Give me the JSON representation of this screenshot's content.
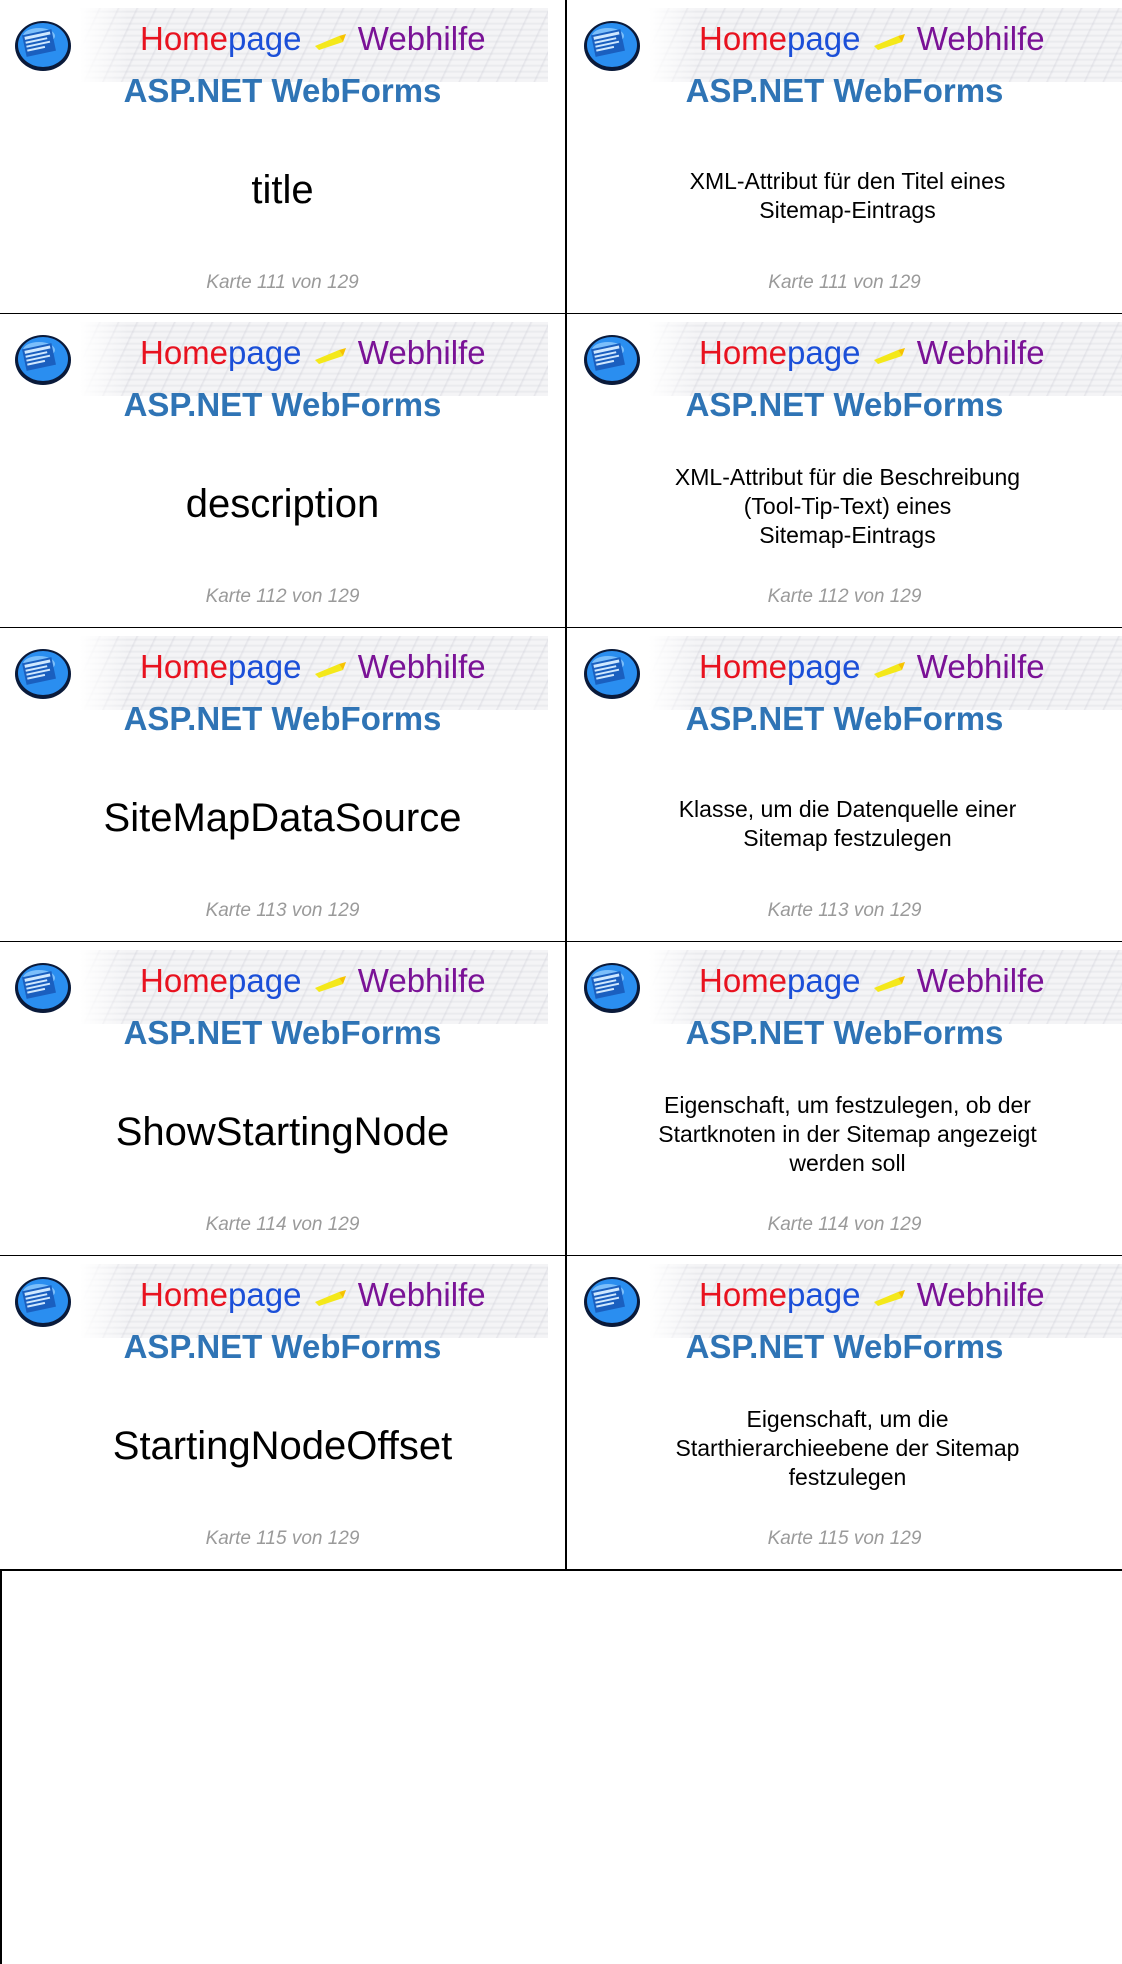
{
  "brand": {
    "home": "Home",
    "page": "page",
    "web": "Webhilfe"
  },
  "subject": "ASP.NET WebForms",
  "colors": {
    "subject": "#2f74b5",
    "home": "#e8121f",
    "page": "#1b4fd8",
    "web": "#7a1296",
    "footer": "#9a9a9a"
  },
  "cards": [
    {
      "term": "title",
      "answer": [
        "XML-Attribut für den Titel eines",
        "Sitemap-Eintrags"
      ],
      "footer": "Karte 111 von 129"
    },
    {
      "term": "description",
      "answer": [
        "XML-Attribut für die Beschreibung",
        "(Tool-Tip-Text) eines",
        "Sitemap-Eintrags"
      ],
      "footer": "Karte 112 von 129"
    },
    {
      "term": "SiteMapDataSource",
      "answer": [
        "Klasse, um die Datenquelle einer",
        "Sitemap festzulegen"
      ],
      "footer": "Karte 113 von 129"
    },
    {
      "term": "ShowStartingNode",
      "answer": [
        "Eigenschaft, um festzulegen, ob der",
        "Startknoten in der Sitemap angezeigt",
        "werden soll"
      ],
      "footer": "Karte 114 von 129"
    },
    {
      "term": "StartingNodeOffset",
      "answer": [
        "Eigenschaft, um die",
        "Starthierarchieebene der Sitemap",
        "festzulegen"
      ],
      "footer": "Karte 115 von 129"
    }
  ]
}
